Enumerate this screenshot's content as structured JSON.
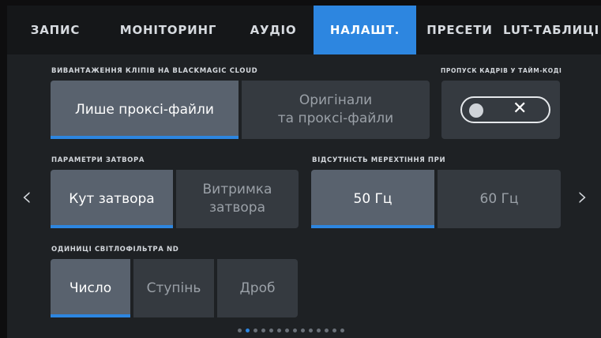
{
  "tabs": [
    {
      "label": "ЗАПИС",
      "active": false
    },
    {
      "label": "МОНІТОРИНГ",
      "active": false
    },
    {
      "label": "АУДІО",
      "active": false
    },
    {
      "label": "НАЛАШТ.",
      "active": true
    },
    {
      "label": "ПРЕСЕТИ",
      "active": false
    },
    {
      "label": "LUT-ТАБЛИЦІ",
      "active": false
    }
  ],
  "cloud_upload": {
    "label": "ВИВАНТАЖЕННЯ КЛІПІВ НА BLACKMAGIC CLOUD",
    "options": [
      "Лише проксі-файли",
      "Оригінали\nта проксі-файли"
    ],
    "selected": "Лише проксі-файли"
  },
  "drop_frame": {
    "label": "ПРОПУСК КАДРІВ У ТАЙМ-КОДІ",
    "state": "off"
  },
  "shutter": {
    "label": "ПАРАМЕТРИ ЗАТВОРА",
    "options": [
      "Кут затвора",
      "Витримка\nзатвора"
    ],
    "selected": "Кут затвора"
  },
  "flicker": {
    "label": "ВІДСУТНІСТЬ МЕРЕХТІННЯ ПРИ",
    "options": [
      "50 Гц",
      "60 Гц"
    ],
    "selected": "50 Гц"
  },
  "nd_units": {
    "label": "ОДИНИЦІ СВІТЛОФІЛЬТРА ND",
    "options": [
      "Число",
      "Ступінь",
      "Дроб"
    ],
    "selected": "Число"
  },
  "pagination": {
    "current": 2,
    "total": 14
  },
  "colors": {
    "accent": "#2d86e0",
    "panel": "#1e2124",
    "button": "#353a40",
    "button_selected": "#59626e"
  }
}
